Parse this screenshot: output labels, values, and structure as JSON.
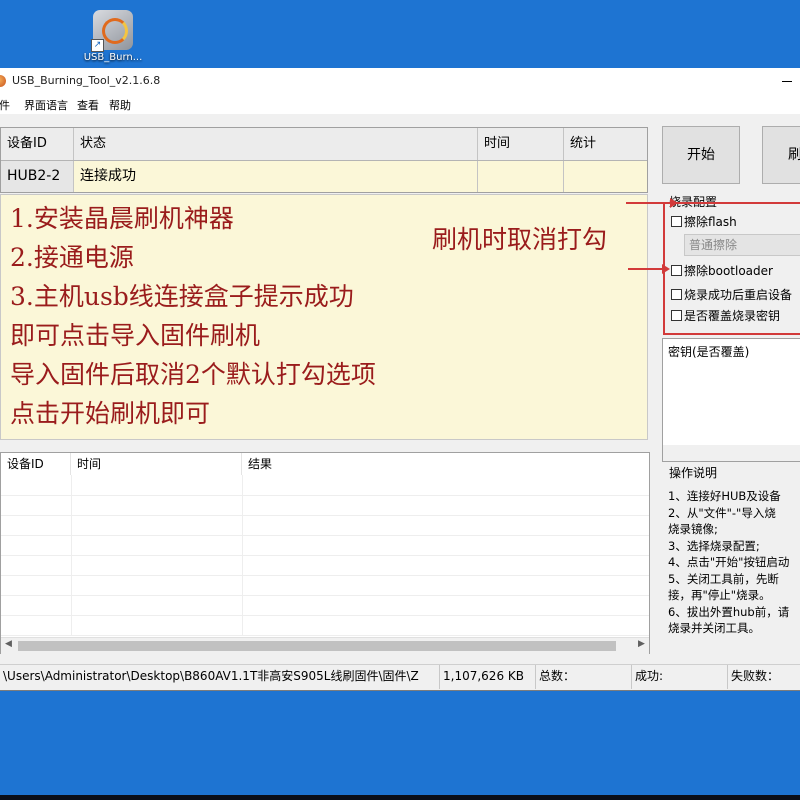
{
  "desktop": {
    "shortcut_label": "USB_Burn..."
  },
  "window": {
    "title": "USB_Burning_Tool_v2.1.6.8",
    "menu": [
      "文件",
      "界面语言",
      "查看",
      "帮助"
    ]
  },
  "device_grid": {
    "headers": [
      "设备ID",
      "状态",
      "时间",
      "统计"
    ],
    "rows": [
      {
        "device_id": "HUB2-2",
        "status": "连接成功",
        "time": "",
        "stats": ""
      }
    ]
  },
  "instructions": {
    "lines": [
      "1.安装晶晨刷机神器",
      "2.接通电源",
      "3.主机usb线连接盒子提示成功",
      "即可点击导入固件刷机",
      "导入固件后取消2个默认打勾选项",
      "点击开始刷机即可"
    ],
    "uncheck_hint": "刷机时取消打勾"
  },
  "log_table": {
    "headers": [
      "设备ID",
      "时间",
      "结果"
    ]
  },
  "buttons": {
    "start": "开始",
    "stop_partial": "刷"
  },
  "burn_config": {
    "label": "烧录配置",
    "erase_flash": "擦除flash",
    "erase_mode": "普通擦除",
    "erase_bootloader": "擦除bootloader",
    "reboot_after": "烧录成功后重启设备",
    "overwrite_key": "是否覆盖烧录密钥"
  },
  "key_box": {
    "label": "密钥(是否覆盖)"
  },
  "instructions_panel": {
    "label": "操作说明",
    "lines": [
      "1、连接好HUB及设备",
      "2、从\"文件\"-\"导入烧",
      "烧录镜像;",
      "3、选择烧录配置;",
      "4、点击\"开始\"按钮启动",
      "5、关闭工具前，先断",
      "接，再\"停止\"烧录。",
      "6、拔出外置hub前，请",
      "烧录并关闭工具。"
    ]
  },
  "statusbar": {
    "path": "\\Users\\Administrator\\Desktop\\B860AV1.1T非高安S905L线刷固件\\固件\\Z",
    "size": "1,107,626 KB",
    "total_label": "总数：",
    "success_label": "成功:",
    "fail_label": "失败数："
  },
  "colors": {
    "desktop": "#1e74d2",
    "annotation": "#9a1c1c",
    "highlight_box": "#d23a3a",
    "grid_bg": "#fbf7d8"
  }
}
